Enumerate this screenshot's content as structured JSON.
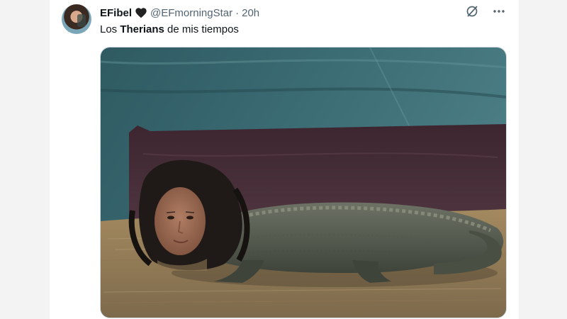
{
  "tweet": {
    "author_name": "EFibel",
    "handle": "@EFmorningStar",
    "separator": "·",
    "time": "20h",
    "text_before": "Los ",
    "text_bold": "Therians",
    "text_after": " de mis tiempos"
  },
  "icons": {
    "badge": "black-heart-icon",
    "grok": "grok-icon",
    "more": "more-icon"
  },
  "colors": {
    "text": "#0f1419",
    "secondary": "#536471",
    "border": "#cfd9de"
  }
}
